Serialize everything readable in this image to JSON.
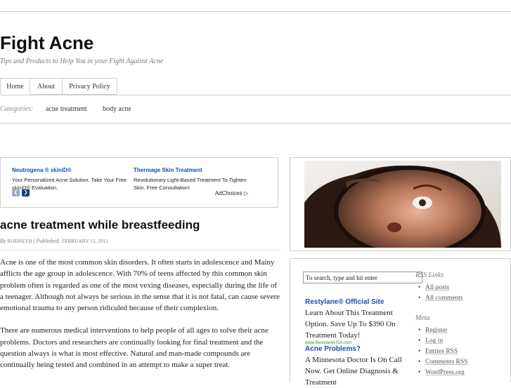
{
  "site": {
    "title": "Fight Acne",
    "tagline": "Tips and Products to Help You in your Fight Against Acne"
  },
  "nav": {
    "tabs": [
      {
        "label": "Home"
      },
      {
        "label": "About"
      },
      {
        "label": "Privacy Policy"
      }
    ]
  },
  "categories": {
    "label": "Categories:",
    "items": [
      "acne treatment",
      "body acne"
    ]
  },
  "ad_box": {
    "ads": [
      {
        "title": "Neutrogena ® skiniD®",
        "text": "Your Personalized Acne Solution. Take Your Free skiniD® Evaluation."
      },
      {
        "title": "Thermage Skin Treatment",
        "text": "Revolutionary Light-Based Treatment To Tighten Skin. Free Consultation!"
      }
    ],
    "prev_icon": "chevron-left-icon",
    "next_icon": "chevron-right-icon",
    "adchoices_label": "AdChoices",
    "colors": {
      "title": "#1a4fb3",
      "arrow_prev": "#9aa9cc",
      "arrow_next": "#1a3a8a"
    }
  },
  "post": {
    "title": "acne treatment while breastfeeding",
    "by_label": "By",
    "author": "RODNEYB",
    "published_label": "Published:",
    "date": "FEBRUARY 13, 2011",
    "paragraphs": [
      "Acne is one of the most common skin disorders. It often starts in adolescence and Mainy afflicts the age group in adolescence. With 70% of teens affected by this common skin problem often is regarded as one of the most vexing diseases, especially during the life of a teenager. Although not always be serious in the sense that it is not fatal, can cause severe emotional trauma to any person ridiculed because of their complexion.",
      "There are numerous medical interventions to help people of all ages to solve their acne problems. Doctors and researchers are continually looking for final treatment and the question always is what is most effective. Natural and man-made compounds are continually being tested and combined in an attempt to make a super treat."
    ]
  },
  "sidebar": {
    "search": {
      "placeholder": "To search, type and hit enter"
    },
    "ads": [
      {
        "title": "Restylane® Official Site",
        "text": "Learn About This Treatment Option. Save Up To $390 On Treatment Today!",
        "url": "www.RestylaneUSA.com"
      },
      {
        "title": "Acne Problems?",
        "text": "A Minnesota Doctor Is On Call Now. Get Online Diagnosis & Treatment"
      }
    ],
    "rss": {
      "title": "RSS Links",
      "items": [
        "All posts",
        "All comments"
      ]
    },
    "meta": {
      "title": "Meta",
      "items": [
        "Register",
        "Log in",
        "Entries RSS",
        "Comments RSS",
        "WordPress.org"
      ]
    }
  },
  "colors": {
    "link_blue": "#1a4fb3",
    "border": "#cfcfcf",
    "ad_url_green": "#2a9a2a"
  }
}
